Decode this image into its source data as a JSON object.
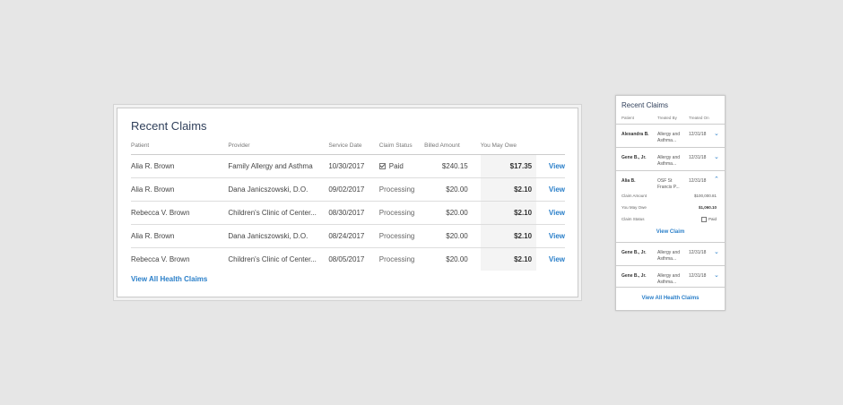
{
  "desktop": {
    "title": "Recent Claims",
    "columns": [
      "Patient",
      "Provider",
      "Service Date",
      "Claim Status",
      "Billed Amount",
      "You May Owe",
      ""
    ],
    "rows": [
      {
        "patient": "Alia R. Brown",
        "provider": "Family Allergy and Asthma",
        "date": "10/30/2017",
        "status": "Paid",
        "billed": "$240.15",
        "owe": "$17.35",
        "action": "View"
      },
      {
        "patient": "Alia R. Brown",
        "provider": "Dana Janicszowski, D.O.",
        "date": "09/02/2017",
        "status": "Processing",
        "billed": "$20.00",
        "owe": "$2.10",
        "action": "View"
      },
      {
        "patient": "Rebecca V. Brown",
        "provider": "Children's Clinic of Center...",
        "date": "08/30/2017",
        "status": "Processing",
        "billed": "$20.00",
        "owe": "$2.10",
        "action": "View"
      },
      {
        "patient": "Alia R. Brown",
        "provider": "Dana Janicszowski, D.O.",
        "date": "08/24/2017",
        "status": "Processing",
        "billed": "$20.00",
        "owe": "$2.10",
        "action": "View"
      },
      {
        "patient": "Rebecca V. Brown",
        "provider": "Children's Clinic of Center...",
        "date": "08/05/2017",
        "status": "Processing",
        "billed": "$20.00",
        "owe": "$2.10",
        "action": "View"
      }
    ],
    "view_all": "View All Health Claims"
  },
  "mobile": {
    "title": "Recent Claims",
    "columns": [
      "Patient",
      "Treated By",
      "Treated On"
    ],
    "rows": [
      {
        "patient": "Alexandra B.",
        "treated_by": "Allergy and Asthma...",
        "date": "12/31/18"
      },
      {
        "patient": "Gene B., Jr.",
        "treated_by": "Allergy and Asthma...",
        "date": "12/31/18"
      },
      {
        "patient": "Alia B.",
        "treated_by": "OSF St Francis P...",
        "date": "12/31/18"
      },
      {
        "patient": "Gene B., Jr.",
        "treated_by": "Allergy and Asthma...",
        "date": "12/31/18"
      },
      {
        "patient": "Gene B., Jr.",
        "treated_by": "Allergy and Asthma...",
        "date": "12/31/18"
      }
    ],
    "expanded": {
      "claim_amount_label": "Claim Amount",
      "claim_amount": "$100,000.81",
      "owe_label": "You May Owe",
      "owe": "$1,060.10",
      "status_label": "Claim Status",
      "status": "Paid",
      "view_claim": "View Claim"
    },
    "view_all": "View All Health Claims"
  },
  "icons": {
    "chevron": "chevron-down-icon",
    "check": "checkbox-check-icon"
  },
  "colors": {
    "link": "#2a7fc9",
    "title": "#2f3f5a"
  }
}
